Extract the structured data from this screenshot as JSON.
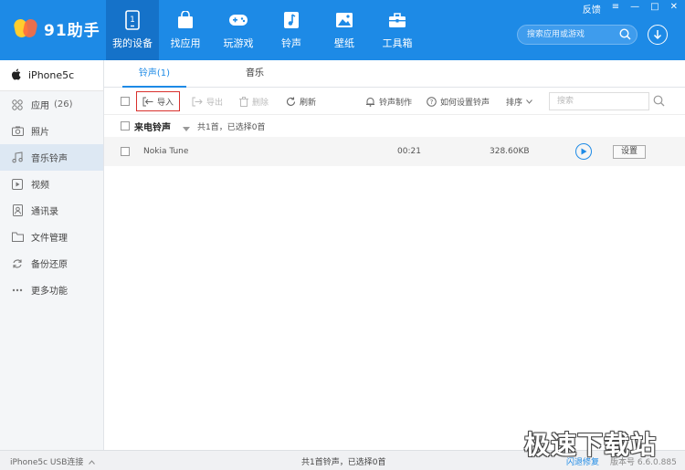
{
  "app": {
    "title": "91助手"
  },
  "window": {
    "feedback": "反馈"
  },
  "nav": [
    {
      "label": "我的设备",
      "icon": "phone-icon"
    },
    {
      "label": "找应用",
      "icon": "bag-icon"
    },
    {
      "label": "玩游戏",
      "icon": "gamepad-icon"
    },
    {
      "label": "铃声",
      "icon": "music-note-icon"
    },
    {
      "label": "壁纸",
      "icon": "picture-icon"
    },
    {
      "label": "工具箱",
      "icon": "toolbox-icon"
    }
  ],
  "search": {
    "placeholder": "搜索应用或游戏"
  },
  "sidebar": {
    "device": "iPhone5c",
    "items": [
      {
        "label": "应用",
        "count": "(26)"
      },
      {
        "label": "照片"
      },
      {
        "label": "音乐铃声"
      },
      {
        "label": "视频"
      },
      {
        "label": "通讯录"
      },
      {
        "label": "文件管理"
      },
      {
        "label": "备份还原"
      },
      {
        "label": "更多功能"
      }
    ]
  },
  "tabs": [
    {
      "label": "铃声(1)"
    },
    {
      "label": "音乐"
    }
  ],
  "toolbar": {
    "import": "导入",
    "export": "导出",
    "delete": "删除",
    "refresh": "刷新",
    "make_ringtone": "铃声制作",
    "how_to_set": "如何设置铃声",
    "sort": "排序",
    "search_placeholder": "搜索"
  },
  "group": {
    "title": "来电铃声",
    "info": "共1首，已选择0首"
  },
  "rows": [
    {
      "name": "Nokia Tune",
      "duration": "00:21",
      "size": "328.60KB",
      "action": "设置"
    }
  ],
  "status": {
    "connection": "iPhone5c  USB连接",
    "summary": "共1首铃声，已选择0首",
    "repair": "闪退修复",
    "version": "版本号 6.6.0.885"
  },
  "watermark": "极速下载站",
  "colors": {
    "brand": "#1d8ae6",
    "active_nav": "#1572c9",
    "highlight": "#d9302c"
  }
}
